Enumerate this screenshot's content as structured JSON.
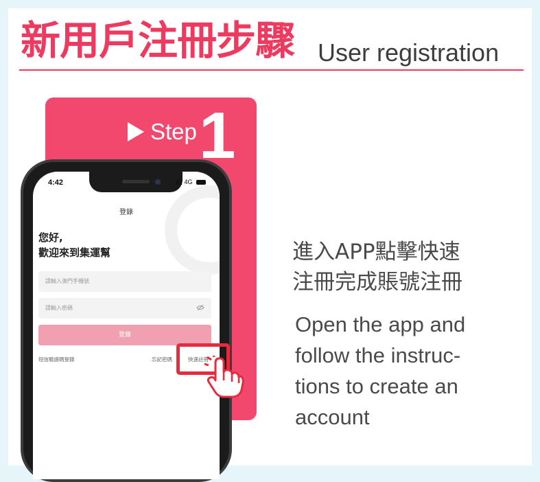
{
  "header": {
    "title_zh": "新用戶注冊步驟",
    "title_en": "User registration"
  },
  "step": {
    "label": "Step",
    "number": "1"
  },
  "phone": {
    "status_time": "4:42",
    "status_signal": "4G",
    "app_title": "登錄",
    "greeting_line1": "您好,",
    "greeting_line2": "歡迎來到集運幫",
    "phone_placeholder": "請輸入澳門手機號",
    "password_placeholder": "請輸入密碼",
    "login_button": "登錄",
    "sms_login_link": "短信驗證碼登錄",
    "forgot_password_link": "忘記密碼",
    "quick_register_link": "快速註冊"
  },
  "description": {
    "zh_line1": "進入APP點擊快速",
    "zh_line2": "注冊完成賬號注冊",
    "en_line1": "Open the app and",
    "en_line2": "follow the instruc-",
    "en_line3": "tions to create an",
    "en_line4": "account"
  },
  "colors": {
    "accent_pink": "#ed3a5e",
    "card_pink": "#f2486d",
    "highlight_red": "#e52b3d",
    "background": "#e6f5f9"
  }
}
